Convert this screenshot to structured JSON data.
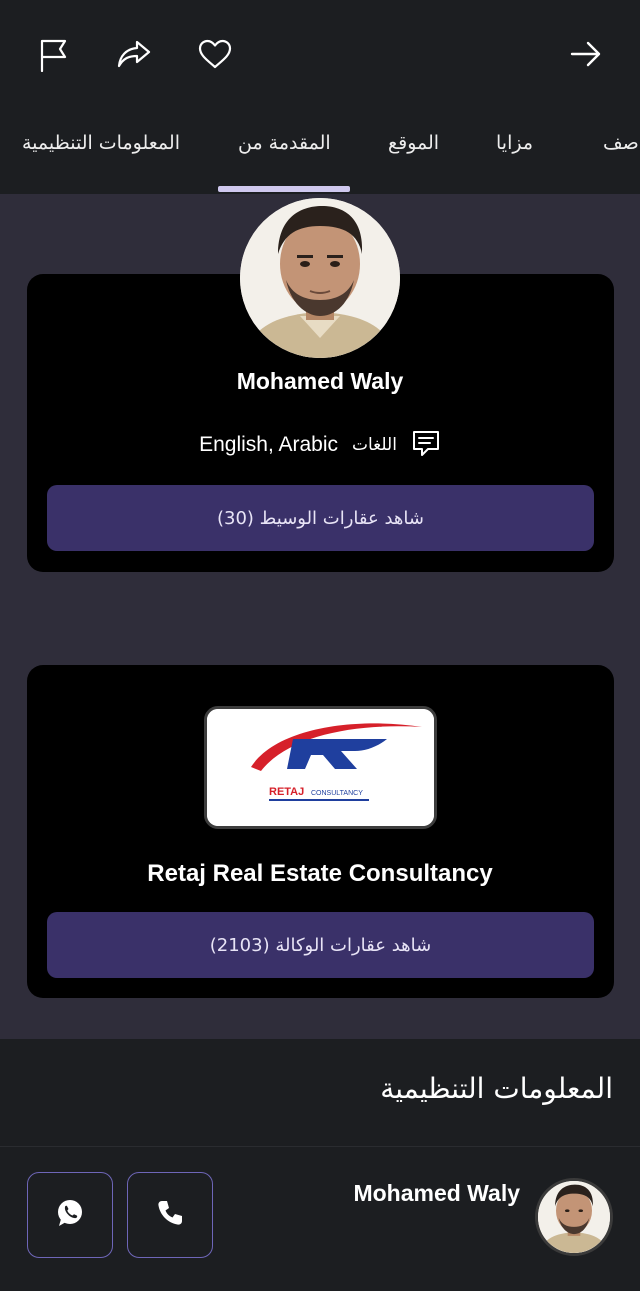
{
  "toolbar": {
    "icons": [
      "flag-icon",
      "share-icon",
      "heart-icon",
      "arrow-right-icon"
    ]
  },
  "tabs": [
    {
      "label": "المعلومات التنظيمية"
    },
    {
      "label": "المقدمة من"
    },
    {
      "label": "الموقع"
    },
    {
      "label": "مزايا"
    },
    {
      "label": "صف"
    }
  ],
  "agent": {
    "name": "Mohamed Waly",
    "languages_label": "اللغات",
    "languages": "English, Arabic",
    "view_listings": "(30) شاهد عقارات الوسيط"
  },
  "agency": {
    "name": "Retaj Real Estate Consultancy",
    "logo_text": "RETAJ",
    "logo_sub": "CONSULTANCY",
    "view_listings": "شاهد عقارات الوكالة (2103)"
  },
  "regulatory": {
    "title": "المعلومات التنظيمية"
  },
  "contact": {
    "name": "Mohamed Waly"
  },
  "colors": {
    "accent": "#3a3169",
    "underline": "#cfc8ee",
    "border": "#6e66b8"
  }
}
